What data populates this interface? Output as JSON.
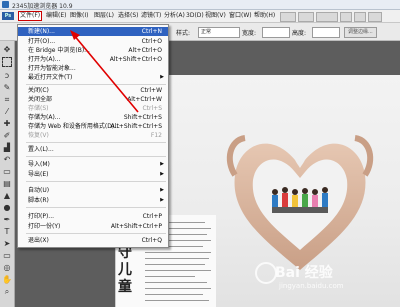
{
  "window": {
    "title": "2345加速浏览器 10.9"
  },
  "menubar": {
    "badge": "Ps",
    "items": [
      "文件(F)",
      "编辑(E)",
      "图像(I)",
      "图层(L)",
      "选择(S)",
      "滤镜(T)",
      "分析(A)",
      "3D(D)",
      "视图(V)",
      "窗口(W)",
      "帮助(H)"
    ]
  },
  "options": {
    "style_label": "样式:",
    "style_value": "正常",
    "width_label": "宽度:",
    "height_label": "高度:",
    "refine_button": "调整边缘..."
  },
  "file_menu": {
    "items": [
      {
        "label": "新建(N)...",
        "shortcut": "Ctrl+N",
        "state": "highlighted"
      },
      {
        "label": "打开(O)...",
        "shortcut": "Ctrl+O"
      },
      {
        "label": "在 Bridge 中浏览(B)...",
        "shortcut": "Alt+Ctrl+O"
      },
      {
        "label": "打开为(A)...",
        "shortcut": "Alt+Shift+Ctrl+O"
      },
      {
        "label": "打开为智能对象..."
      },
      {
        "label": "最近打开文件(T)",
        "submenu": true
      },
      {
        "label": "关闭(C)",
        "shortcut": "Ctrl+W"
      },
      {
        "label": "关闭全部",
        "shortcut": "Alt+Ctrl+W"
      },
      {
        "label": "存储(S)",
        "shortcut": "Ctrl+S",
        "state": "disabled"
      },
      {
        "label": "存储为(A)...",
        "shortcut": "Shift+Ctrl+S"
      },
      {
        "label": "存储为 Web 和设备所用格式(D)...",
        "shortcut": "Alt+Shift+Ctrl+S"
      },
      {
        "label": "恢复(V)",
        "shortcut": "F12",
        "state": "disabled"
      },
      {
        "label": "置入(L)..."
      },
      {
        "label": "导入(M)",
        "submenu": true
      },
      {
        "label": "导出(E)",
        "submenu": true
      },
      {
        "label": "自动(U)",
        "submenu": true
      },
      {
        "label": "脚本(R)",
        "submenu": true
      },
      {
        "label": "打印(P)...",
        "shortcut": "Ctrl+P"
      },
      {
        "label": "打印一份(Y)",
        "shortcut": "Alt+Shift+Ctrl+P"
      },
      {
        "label": "退出(X)",
        "shortcut": "Ctrl+Q"
      }
    ]
  },
  "document": {
    "vertical_title": "守儿童"
  },
  "watermark": {
    "main": "Bai 经验",
    "sub": "jingyan.baidu.com"
  },
  "colors": {
    "highlight": "#2f62c0",
    "annotation": "#e00000"
  }
}
